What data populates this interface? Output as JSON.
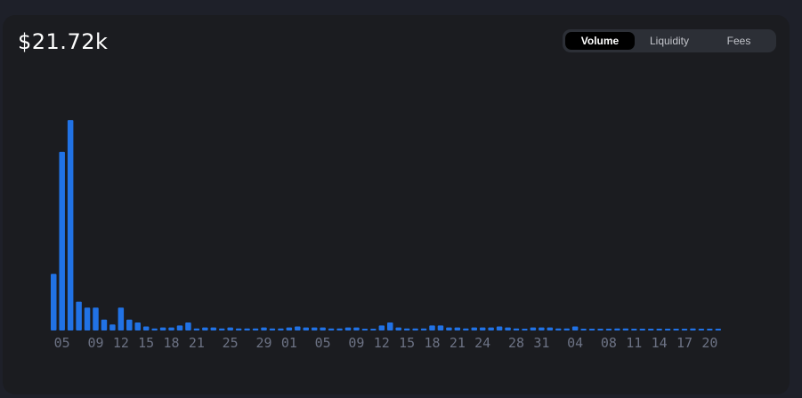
{
  "header": {
    "value": "$21.72k"
  },
  "toggle": {
    "options": [
      "Volume",
      "Liquidity",
      "Fees"
    ],
    "active": "Volume"
  },
  "colors": {
    "bar": "#2172e5",
    "background": "#1b1c20",
    "tick": "#6c7284"
  },
  "chart_data": {
    "type": "bar",
    "title": "",
    "xlabel": "",
    "ylabel": "",
    "grid": false,
    "legend": "none",
    "tick_labels": [
      "05",
      "09",
      "12",
      "15",
      "18",
      "21",
      "25",
      "29",
      "01",
      "05",
      "09",
      "12",
      "15",
      "18",
      "21",
      "24",
      "28",
      "31",
      "04",
      "08",
      "11",
      "14",
      "17",
      "20"
    ],
    "tick_bar_index": [
      1,
      5,
      8,
      11,
      14,
      17,
      21,
      25,
      28,
      32,
      36,
      39,
      42,
      45,
      48,
      51,
      55,
      58,
      62,
      66,
      69,
      72,
      75,
      78
    ],
    "values": [
      5.7,
      18.0,
      21.2,
      2.9,
      2.3,
      2.3,
      1.1,
      0.6,
      2.3,
      1.1,
      0.8,
      0.4,
      0.2,
      0.3,
      0.3,
      0.5,
      0.8,
      0.2,
      0.3,
      0.3,
      0.2,
      0.3,
      0.2,
      0.2,
      0.2,
      0.3,
      0.2,
      0.2,
      0.3,
      0.4,
      0.3,
      0.3,
      0.3,
      0.2,
      0.2,
      0.3,
      0.3,
      0.1,
      0.1,
      0.5,
      0.8,
      0.3,
      0.2,
      0.2,
      0.2,
      0.5,
      0.5,
      0.3,
      0.3,
      0.2,
      0.3,
      0.3,
      0.3,
      0.4,
      0.3,
      0.2,
      0.1,
      0.3,
      0.3,
      0.3,
      0.2,
      0.2,
      0.4,
      0.1,
      0.1,
      0.1,
      0.1,
      0.2,
      0.2,
      0.1,
      0.1,
      0.1,
      0.1,
      0.1,
      0.1,
      0.1,
      0.2,
      0.1,
      0.1,
      0.1
    ],
    "ylim": [
      0,
      23
    ]
  }
}
